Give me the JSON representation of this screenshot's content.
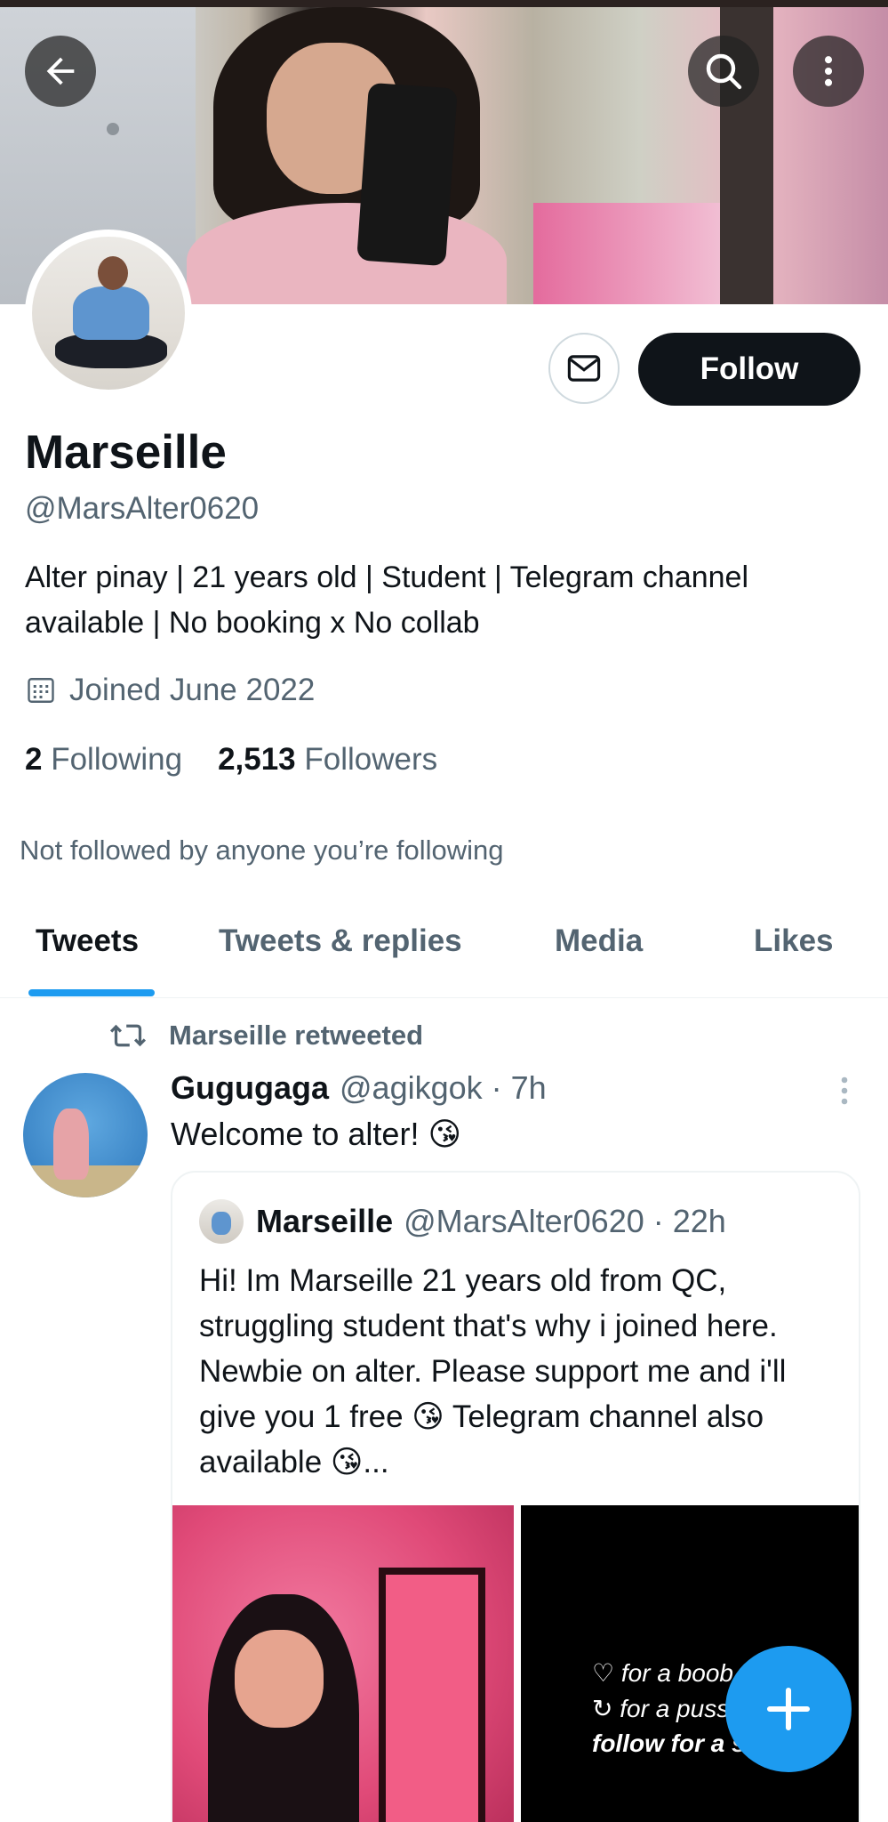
{
  "profile": {
    "name": "Marseille",
    "handle": "@MarsAlter0620",
    "bio": "Alter pinay | 21 years old | Student | Telegram channel available | No booking x No collab",
    "joined": "Joined June 2022",
    "following_count": "2",
    "following_label": "Following",
    "followers_count": "2,513",
    "followers_label": "Followers",
    "not_followed_note": "Not followed by anyone you’re following",
    "follow_button": "Follow"
  },
  "tabs": [
    {
      "label": "Tweets",
      "active": true
    },
    {
      "label": "Tweets & replies",
      "active": false
    },
    {
      "label": "Media",
      "active": false
    },
    {
      "label": "Likes",
      "active": false
    }
  ],
  "tweet": {
    "retweet_note": "Marseille retweeted",
    "author_name": "Gugugaga",
    "author_meta": "@agikgok · 7h",
    "text": "Welcome to alter! 😘",
    "quote": {
      "author_name": "Marseille",
      "author_meta": "@MarsAlter0620 · 22h",
      "text": "Hi! Im Marseille 21 years old from QC, struggling student that's why i joined here. Newbie on alter. Please support me and i'll give you 1 free 😘 Telegram channel also available 😘...",
      "media_text": [
        "♡ for a boob",
        "↻ for a puss",
        "follow for a s"
      ]
    }
  },
  "colors": {
    "accent": "#1d9bf0",
    "text_primary": "#0f1419",
    "text_secondary": "#536471"
  },
  "icons": [
    "back-arrow-icon",
    "search-icon",
    "more-vertical-icon",
    "mail-icon",
    "calendar-icon",
    "retweet-icon",
    "plus-icon"
  ]
}
